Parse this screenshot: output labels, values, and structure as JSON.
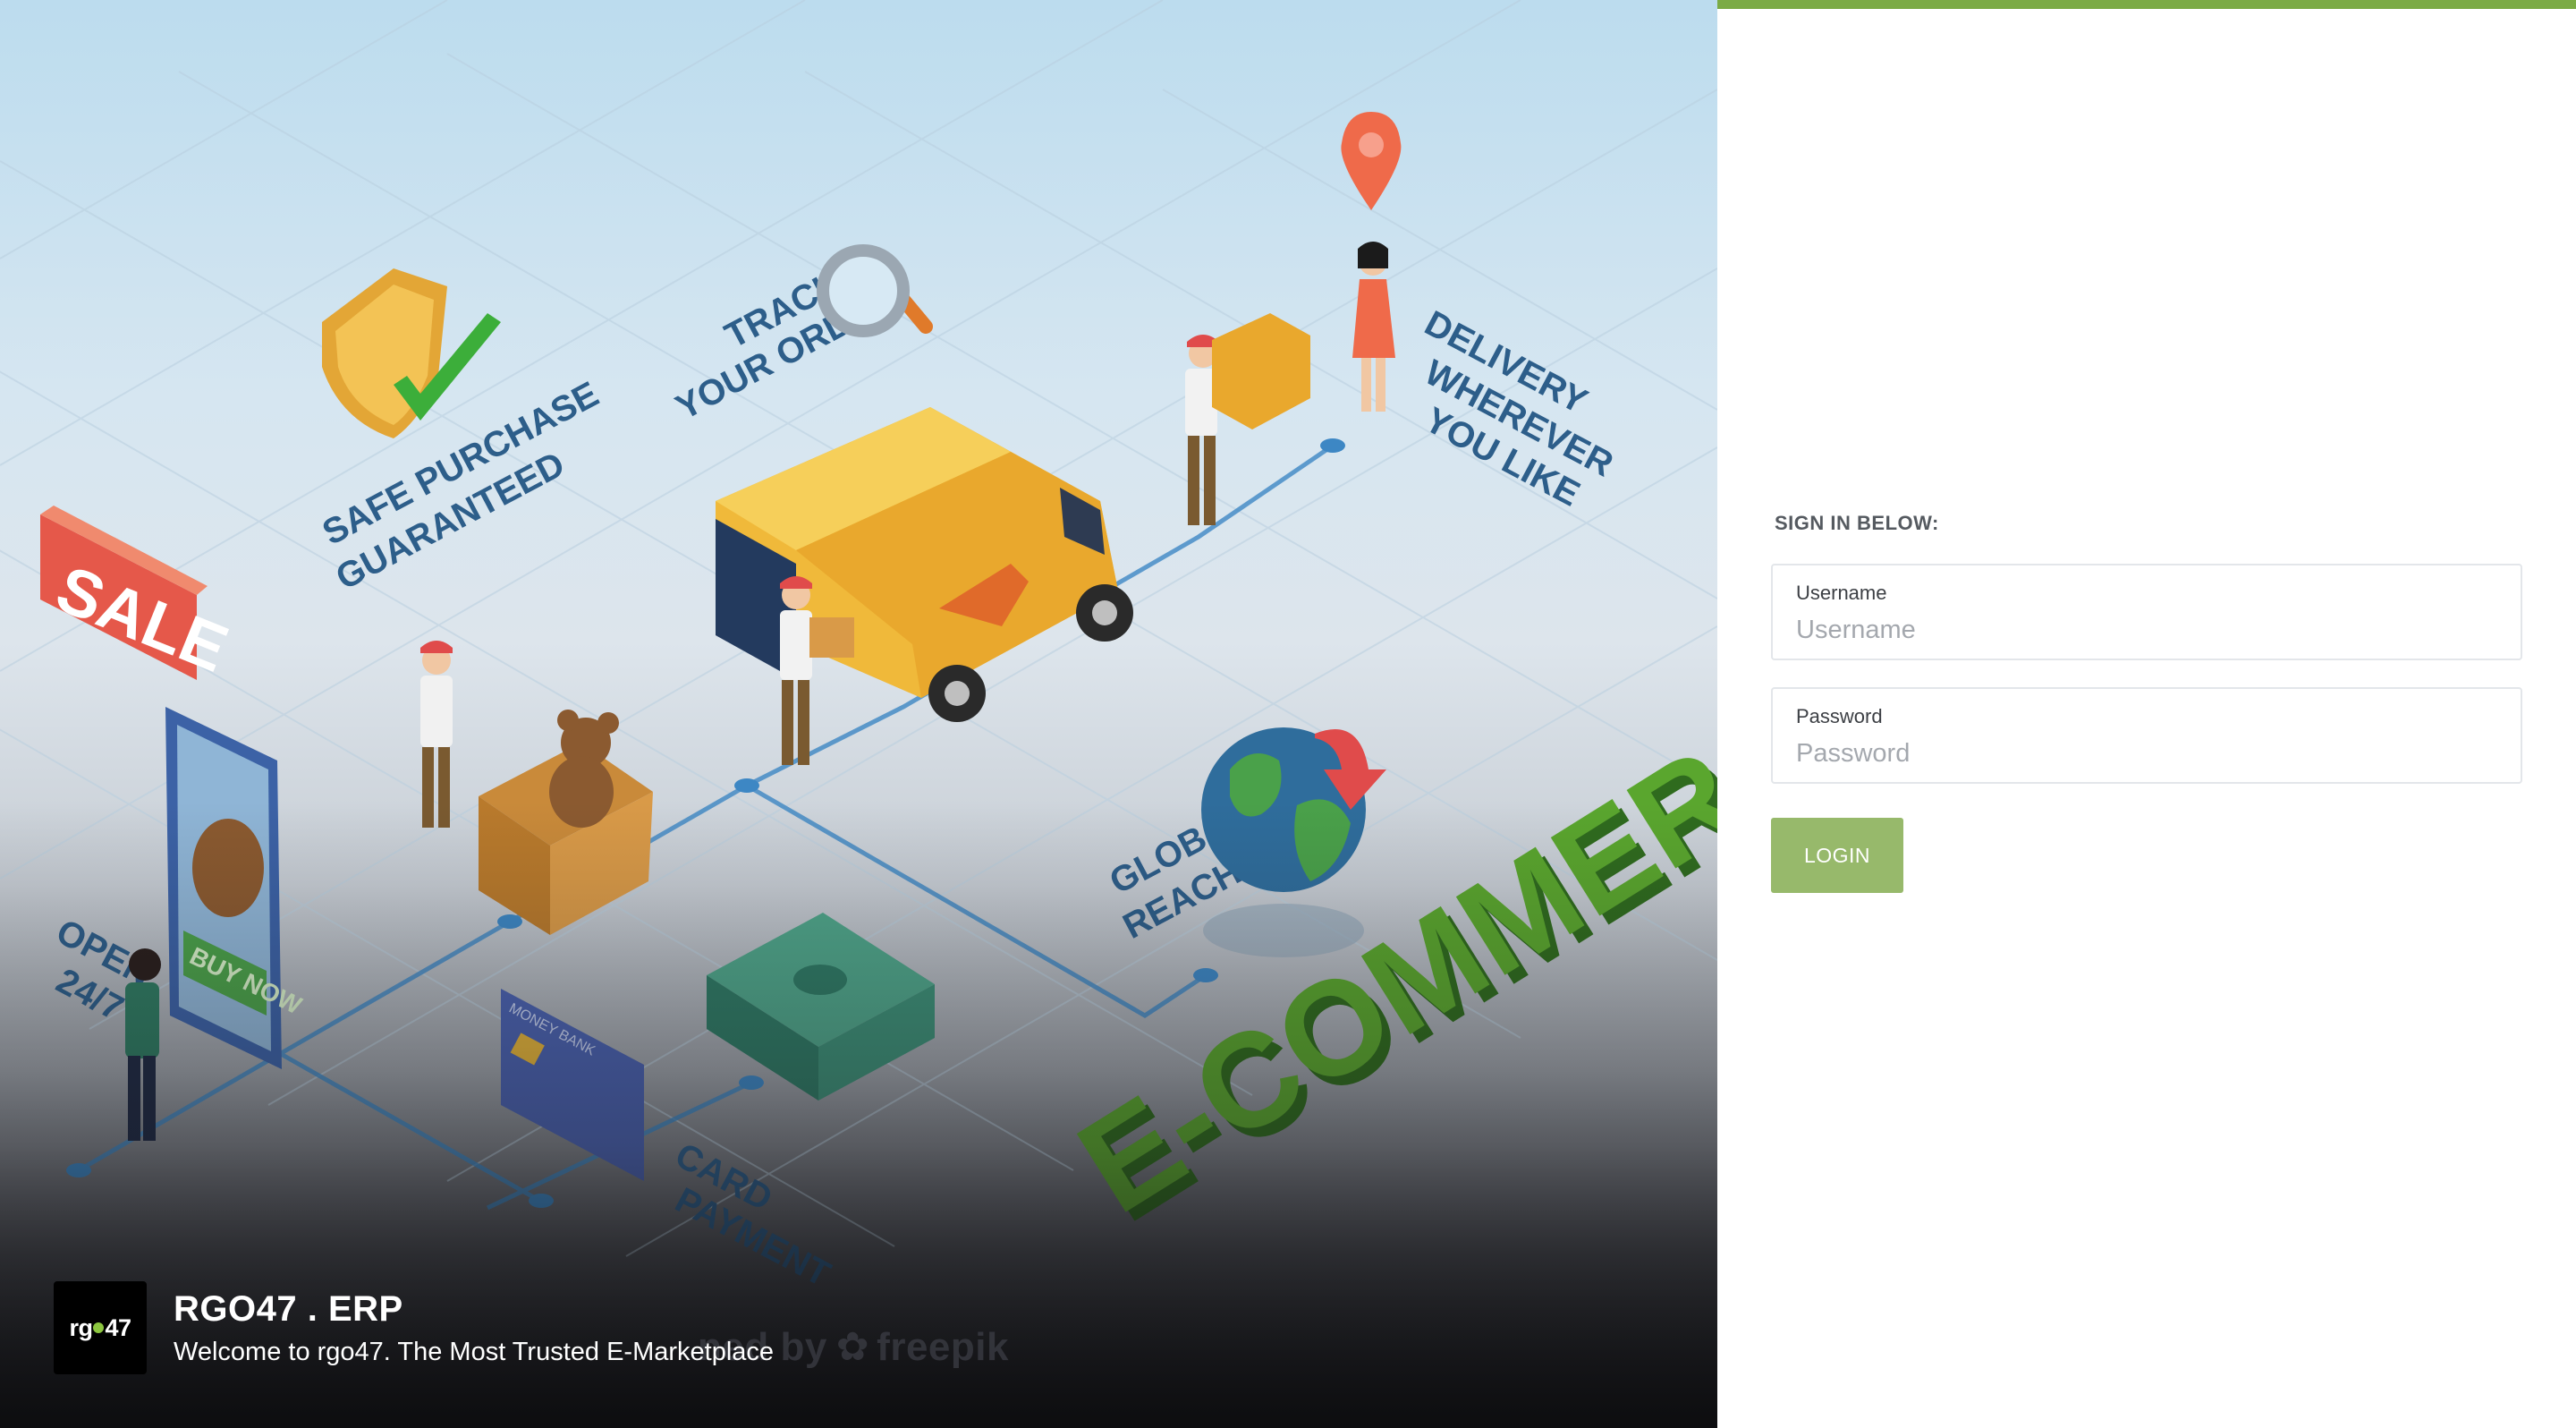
{
  "hero": {
    "art_labels": {
      "track": "TRACK",
      "your_order": "YOUR ORDER",
      "safe_purchase": "SAFE PURCHASE",
      "guaranteed": "GUARANTEED",
      "delivery": "DELIVERY",
      "wherever": "WHEREVER",
      "you_like": "YOU LIKE",
      "sale": "SALE",
      "buy_now": "BUY NOW",
      "open": "OPEN",
      "open_hours": "24/7",
      "global": "GLOBAL",
      "reach": "REACH",
      "card": "CARD",
      "payment": "PAYMENT",
      "ecommerce": "E-COMMERCE",
      "money_bank": "MONEY BANK"
    },
    "watermark": {
      "prefix": "ned by",
      "brand": "freepik"
    },
    "brand": {
      "logo_text_left": "rg",
      "logo_text_right": "47",
      "title": "RGO47 . ERP",
      "subtitle": "Welcome to rgo47. The Most Trusted E-Marketplace"
    }
  },
  "login_form": {
    "heading": "SIGN IN BELOW:",
    "username": {
      "label": "Username",
      "placeholder": "Username",
      "value": ""
    },
    "password": {
      "label": "Password",
      "placeholder": "Password",
      "value": ""
    },
    "submit_label": "LOGIN"
  },
  "colors": {
    "accent": "#7bab45",
    "button": "#97b96b",
    "logo_dot": "#8cc63f"
  },
  "icons": [
    "shield-check-icon",
    "magnifier-icon",
    "location-pin-icon",
    "globe-icon",
    "freepik-logo-icon"
  ]
}
